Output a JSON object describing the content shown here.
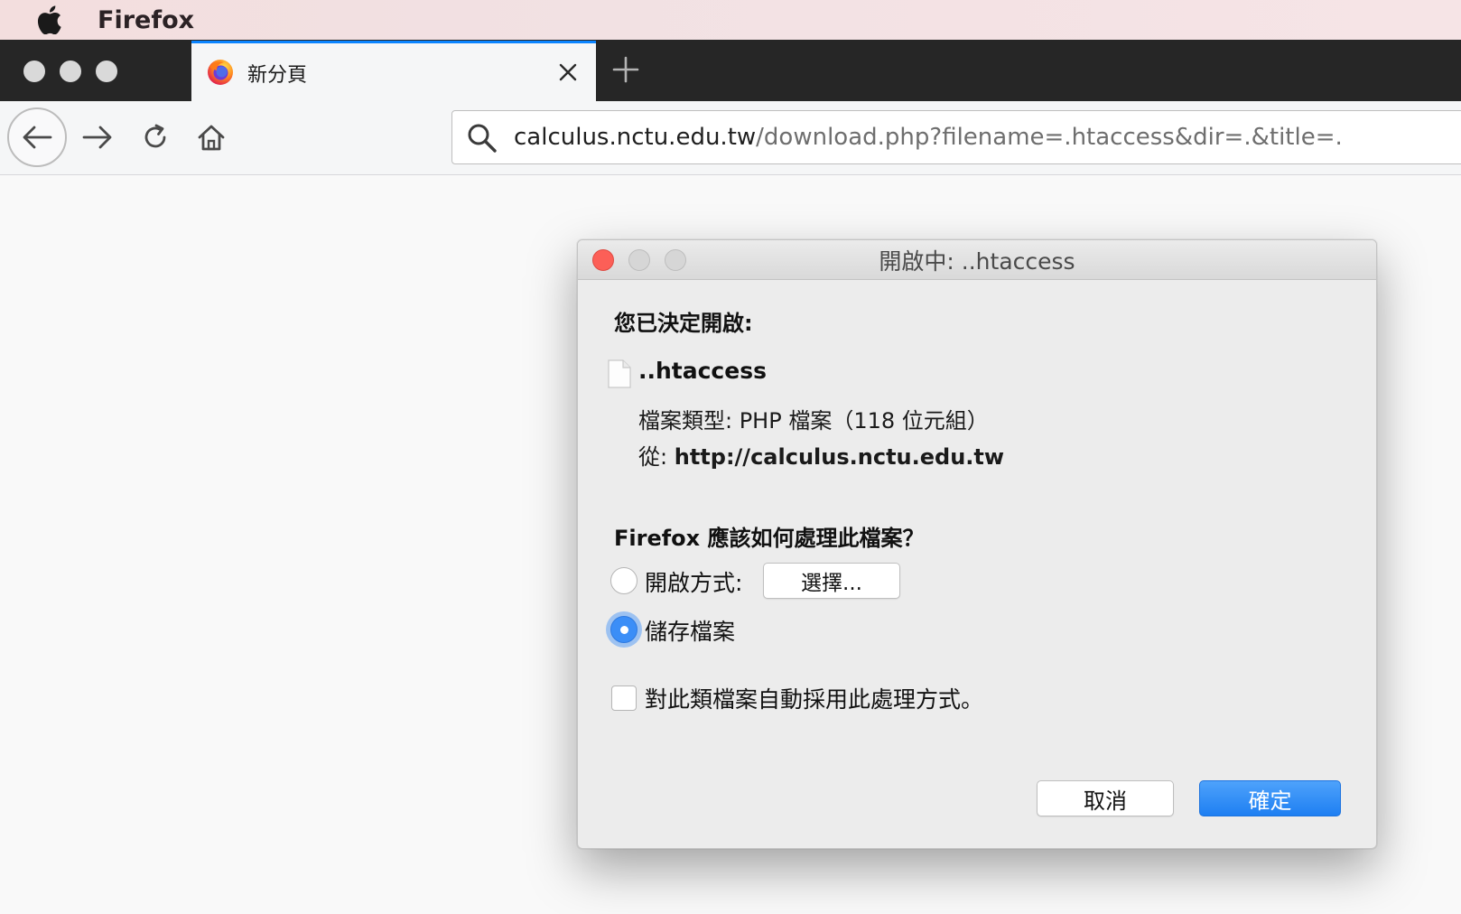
{
  "menubar": {
    "app_name": "Firefox",
    "apple_icon": "apple-icon"
  },
  "tabs": [
    {
      "title": "新分頁",
      "icon": "firefox-icon",
      "active": true
    }
  ],
  "navbar": {
    "url_domain": "calculus.nctu.edu.tw",
    "url_path": "/download.php?filename=.htaccess&dir=.&title=."
  },
  "dialog": {
    "title": "開啟中: ..htaccess",
    "intro": "您已決定開啟:",
    "file_name": "..htaccess",
    "file_type": "檔案類型: PHP 檔案（118 位元組）",
    "from_label": "從:",
    "from_url": "http://calculus.nctu.edu.tw",
    "question": "Firefox 應該如何處理此檔案？",
    "open_with_label": "開啟方式:",
    "choose_label": "選擇...",
    "save_label": "儲存檔案",
    "auto_label": "對此類檔案自動採用此處理方式。",
    "cancel_label": "取消",
    "ok_label": "確定",
    "selected_option": "save"
  },
  "colors": {
    "accent": "#0a84ff",
    "dialog_ok": "#2b86f5",
    "tabstrip": "#262626"
  }
}
